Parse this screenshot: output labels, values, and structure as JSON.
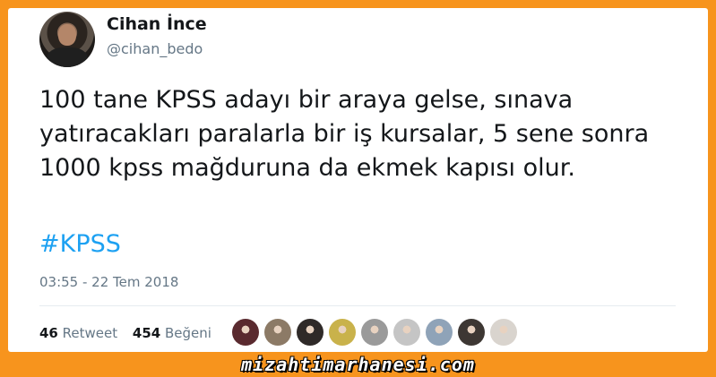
{
  "tweet": {
    "author_name": "Cihan İnce",
    "author_handle": "@cihan_bedo",
    "text": "100 tane KPSS adayı bir araya gelse, sınava yatıracakları paralarla bir iş kursalar, 5 sene sonra 1000 kpss mağduruna da ekmek kapısı olur.",
    "hashtag": "#KPSS",
    "timestamp": "03:55 - 22 Tem 2018",
    "retweet_count": "46",
    "retweet_label": "Retweet",
    "like_count": "454",
    "like_label": "Beğeni"
  },
  "likers": [
    {
      "name": "liker-avatar-1",
      "color": "#5a2a2f"
    },
    {
      "name": "liker-avatar-2",
      "color": "#8c7a66"
    },
    {
      "name": "liker-avatar-3",
      "color": "#2f2a28"
    },
    {
      "name": "liker-avatar-4",
      "color": "#c9b24b"
    },
    {
      "name": "liker-avatar-5",
      "color": "#9a9a9a"
    },
    {
      "name": "liker-avatar-6",
      "color": "#c5c5c5"
    },
    {
      "name": "liker-avatar-7",
      "color": "#8fa3b8"
    },
    {
      "name": "liker-avatar-8",
      "color": "#3d3733"
    },
    {
      "name": "liker-avatar-9",
      "color": "#d9d4ce"
    }
  ],
  "watermark": "mizahtimarhanesi.com",
  "colors": {
    "frame": "#f7941d",
    "link": "#1da1f2",
    "text": "#14171a",
    "muted": "#657786"
  }
}
